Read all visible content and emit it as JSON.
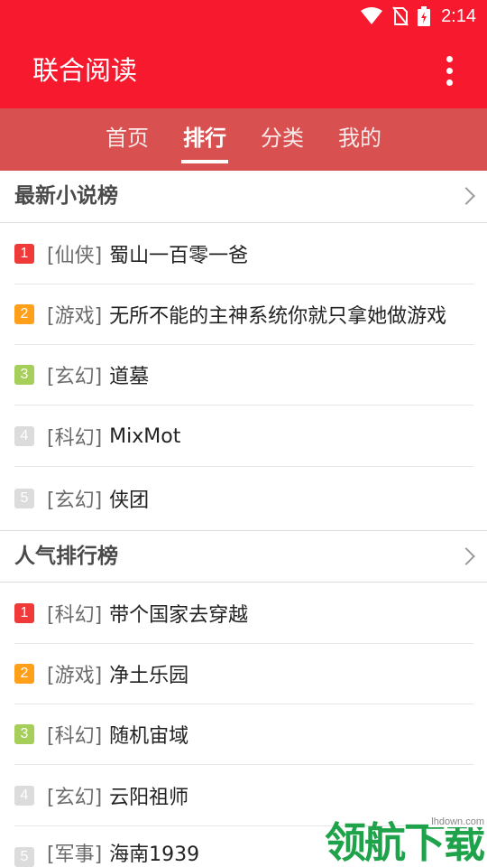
{
  "status": {
    "time": "2:14"
  },
  "app": {
    "title": "联合阅读"
  },
  "tabs": [
    {
      "label": "首页",
      "active": false
    },
    {
      "label": "排行",
      "active": true
    },
    {
      "label": "分类",
      "active": false
    },
    {
      "label": "我的",
      "active": false
    }
  ],
  "sections": [
    {
      "title": "最新小说榜",
      "items": [
        {
          "rank": "1",
          "rank_color": "#f03a3a",
          "category": "[仙侠]",
          "title": "蜀山一百零一爸"
        },
        {
          "rank": "2",
          "rank_color": "#ff9f1a",
          "category": "[游戏]",
          "title": "无所不能的主神系统你就只拿她做游戏"
        },
        {
          "rank": "3",
          "rank_color": "#a5cf5a",
          "category": "[玄幻]",
          "title": "道墓"
        },
        {
          "rank": "4",
          "rank_color": "#dcdcdc",
          "category": "[科幻]",
          "title": "MixMot"
        },
        {
          "rank": "5",
          "rank_color": "#dcdcdc",
          "category": "[玄幻]",
          "title": "侠团"
        }
      ]
    },
    {
      "title": "人气排行榜",
      "items": [
        {
          "rank": "1",
          "rank_color": "#f03a3a",
          "category": "[科幻]",
          "title": "带个国家去穿越"
        },
        {
          "rank": "2",
          "rank_color": "#ff9f1a",
          "category": "[游戏]",
          "title": "净土乐园"
        },
        {
          "rank": "3",
          "rank_color": "#a5cf5a",
          "category": "[科幻]",
          "title": "随机宙域"
        },
        {
          "rank": "4",
          "rank_color": "#dcdcdc",
          "category": "[玄幻]",
          "title": "云阳祖师"
        },
        {
          "rank": "5",
          "rank_color": "#dcdcdc",
          "category": "[军事]",
          "title": "海南1939"
        }
      ]
    }
  ],
  "watermark": {
    "text": "领航下载",
    "url": "lhdown.com"
  },
  "colors": {
    "primary": "#f7192e",
    "tabbar": "#d95050"
  },
  "icons": {
    "wifi": "wifi-icon",
    "no_sim": "no-sim-icon",
    "battery": "battery-charging-icon",
    "more": "more-vert-icon",
    "chevron": "chevron-right-icon"
  }
}
